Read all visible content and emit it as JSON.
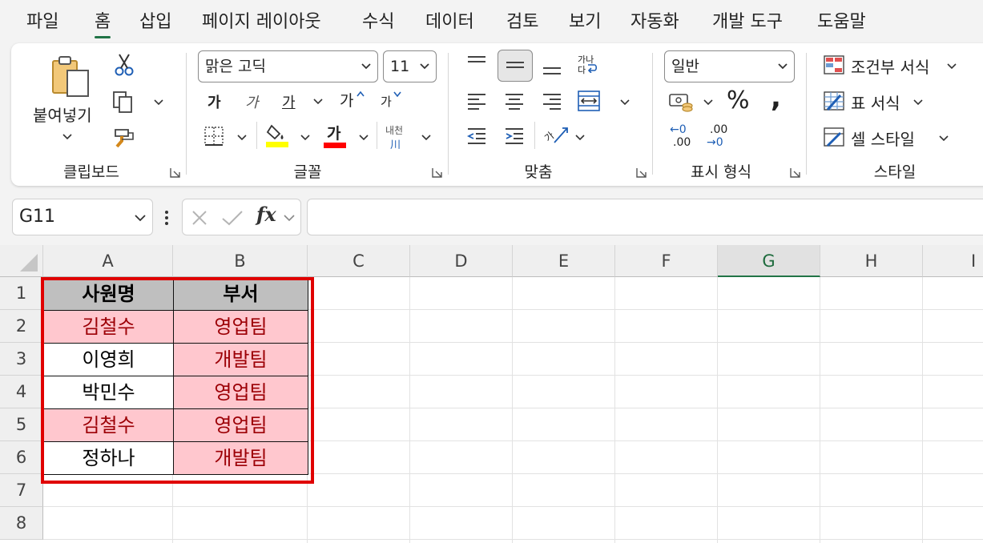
{
  "menu": {
    "tabs": [
      "파일",
      "홈",
      "삽입",
      "페이지 레이아웃",
      "수식",
      "데이터",
      "검토",
      "보기",
      "자동화",
      "개발 도구",
      "도움말"
    ],
    "active": "홈"
  },
  "ribbon": {
    "clipboard": {
      "paste_label": "붙여넣기",
      "group_label": "클립보드"
    },
    "font": {
      "font_name": "맑은 고딕",
      "font_size": "11",
      "bold_glyph": "가",
      "italic_glyph": "가",
      "underline_glyph": "가",
      "grow_glyph": "가",
      "shrink_glyph": "가",
      "font_color_glyph": "가",
      "phonetic_top": "내천",
      "phonetic_bottom": "川",
      "group_label": "글꼴",
      "fill_color": "#ffff00",
      "font_color": "#ff0000"
    },
    "alignment": {
      "wrap_top": "가나",
      "wrap_bottom": "다",
      "orient_glyph": "가",
      "group_label": "맞춤"
    },
    "number": {
      "format": "일반",
      "percent_glyph": "%",
      "comma_glyph": ",",
      "inc_decimal_top": "←0",
      "inc_decimal_bottom": ".00",
      "dec_decimal_top": ".00",
      "dec_decimal_bottom": "→0",
      "group_label": "표시 형식"
    },
    "styles": {
      "conditional_label": "조건부 서식",
      "table_label": "표 서식",
      "cell_style_label": "셀 스타일",
      "group_label": "스타일"
    }
  },
  "formula_bar": {
    "name_box": "G11",
    "fx_label": "fx",
    "formula": ""
  },
  "sheet": {
    "columns": [
      "A",
      "B",
      "C",
      "D",
      "E",
      "F",
      "G",
      "H",
      "I"
    ],
    "selected_column": "G",
    "rows": [
      "1",
      "2",
      "3",
      "4",
      "5",
      "6",
      "7",
      "8"
    ],
    "table": {
      "header": [
        "사원명",
        "부서"
      ],
      "data": [
        [
          "김철수",
          "영업팀"
        ],
        [
          "이영희",
          "개발팀"
        ],
        [
          "박민수",
          "영업팀"
        ],
        [
          "김철수",
          "영업팀"
        ],
        [
          "정하나",
          "개발팀"
        ]
      ],
      "highlight": [
        [
          true,
          true
        ],
        [
          false,
          true
        ],
        [
          false,
          true
        ],
        [
          true,
          true
        ],
        [
          false,
          true
        ]
      ],
      "colors": {
        "header_bg": "#bfbfbf",
        "highlight_bg": "#ffc7ce",
        "highlight_text": "#9c0006",
        "selection_border": "#e00000"
      }
    }
  }
}
